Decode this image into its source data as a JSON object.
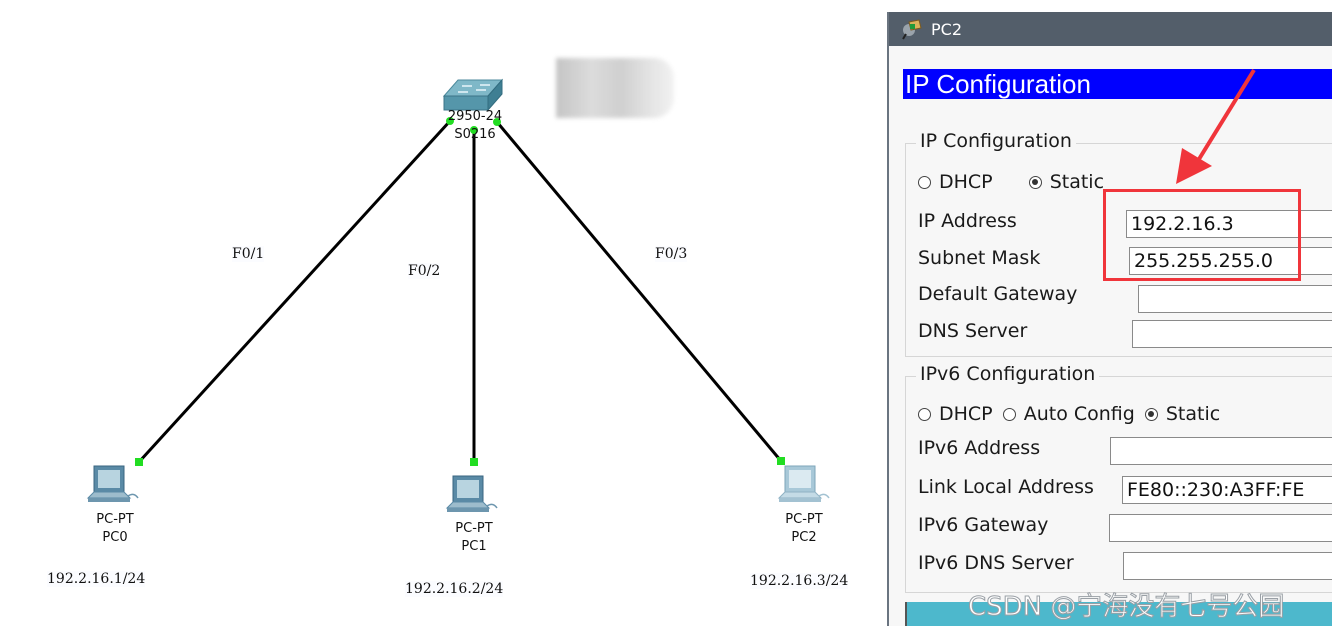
{
  "topology": {
    "switch": {
      "model": "2950-24",
      "name": "S0216"
    },
    "links": [
      {
        "port": "F0/1"
      },
      {
        "port": "F0/2"
      },
      {
        "port": "F0/3"
      }
    ],
    "pcs": [
      {
        "type": "PC-PT",
        "name": "PC0",
        "ip": "192.2.16.1/24"
      },
      {
        "type": "PC-PT",
        "name": "PC1",
        "ip": "192.2.16.2/24"
      },
      {
        "type": "PC-PT",
        "name": "PC2",
        "ip": "192.2.16.3/24"
      }
    ],
    "link_color": "#000000",
    "port_led_color": "#22dd22"
  },
  "dialog": {
    "title": "PC2",
    "banner": "IP Configuration",
    "banner_color": "#0000ff",
    "ipv4": {
      "group_title": "IP Configuration",
      "modes": [
        {
          "label": "DHCP",
          "selected": false
        },
        {
          "label": "Static",
          "selected": true
        }
      ],
      "fields": [
        {
          "label": "IP Address",
          "value": "192.2.16.3"
        },
        {
          "label": "Subnet Mask",
          "value": "255.255.255.0"
        },
        {
          "label": "Default Gateway",
          "value": ""
        },
        {
          "label": "DNS Server",
          "value": ""
        }
      ]
    },
    "ipv6": {
      "group_title": "IPv6 Configuration",
      "modes": [
        {
          "label": "DHCP",
          "selected": false
        },
        {
          "label": "Auto Config",
          "selected": false
        },
        {
          "label": "Static",
          "selected": true
        }
      ],
      "fields": [
        {
          "label": "IPv6 Address",
          "value": ""
        },
        {
          "label": "Link Local Address",
          "value": "FE80::230:A3FF:FE"
        },
        {
          "label": "IPv6 Gateway",
          "value": ""
        },
        {
          "label": "IPv6 DNS Server",
          "value": ""
        }
      ]
    }
  },
  "annotation": {
    "highlight_color": "#f0353b"
  },
  "watermark": "CSDN @宁海没有七号公园"
}
